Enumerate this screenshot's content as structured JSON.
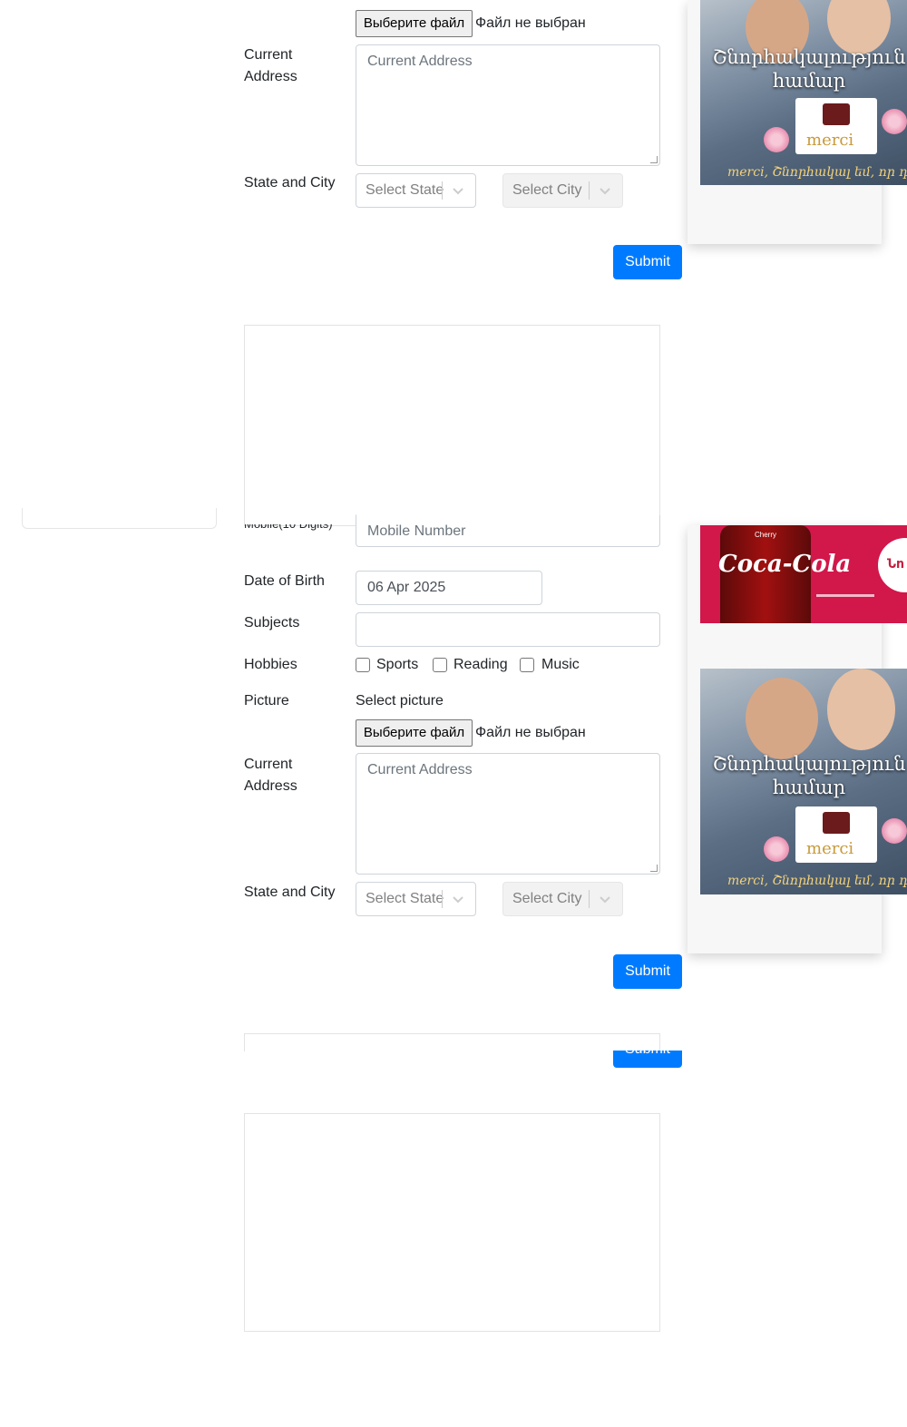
{
  "form_top": {
    "file_button": "Выберите файл",
    "file_status": "Файл не выбран",
    "current_address_label": "Current Address",
    "current_address_placeholder": "Current Address",
    "state_city_label": "State and City",
    "state_placeholder": "Select State",
    "city_placeholder": "Select City",
    "submit": "Submit"
  },
  "form_main": {
    "mobile_label": "Mobile(10 Digits)",
    "mobile_placeholder": "Mobile Number",
    "dob_label": "Date of Birth",
    "dob_value": "06 Apr 2025",
    "subjects_label": "Subjects",
    "hobbies_label": "Hobbies",
    "hobbies": [
      {
        "label": "Sports",
        "checked": false
      },
      {
        "label": "Reading",
        "checked": false
      },
      {
        "label": "Music",
        "checked": false
      }
    ],
    "picture_label": "Picture",
    "select_picture": "Select picture",
    "file_button": "Выберите файл",
    "file_status": "Файл не выбран",
    "current_address_label": "Current Address",
    "current_address_placeholder": "Current Address",
    "state_city_label": "State and City",
    "state_placeholder": "Select State",
    "city_placeholder": "Select City",
    "submit": "Submit"
  },
  "ghost_submit": "Submit",
  "ads": {
    "romance_text": "Շնորհակալություն համար",
    "romance_brand": "merci",
    "romance_tagline": "merci, Շնորհակալ եմ, որ դու",
    "coke_logo": "Coca-Cola",
    "coke_flavor": "Cherry",
    "coke_circle_text": "Նո"
  },
  "colors": {
    "primary": "#007bff",
    "border": "#ced4da",
    "placeholder": "#6c757d"
  }
}
